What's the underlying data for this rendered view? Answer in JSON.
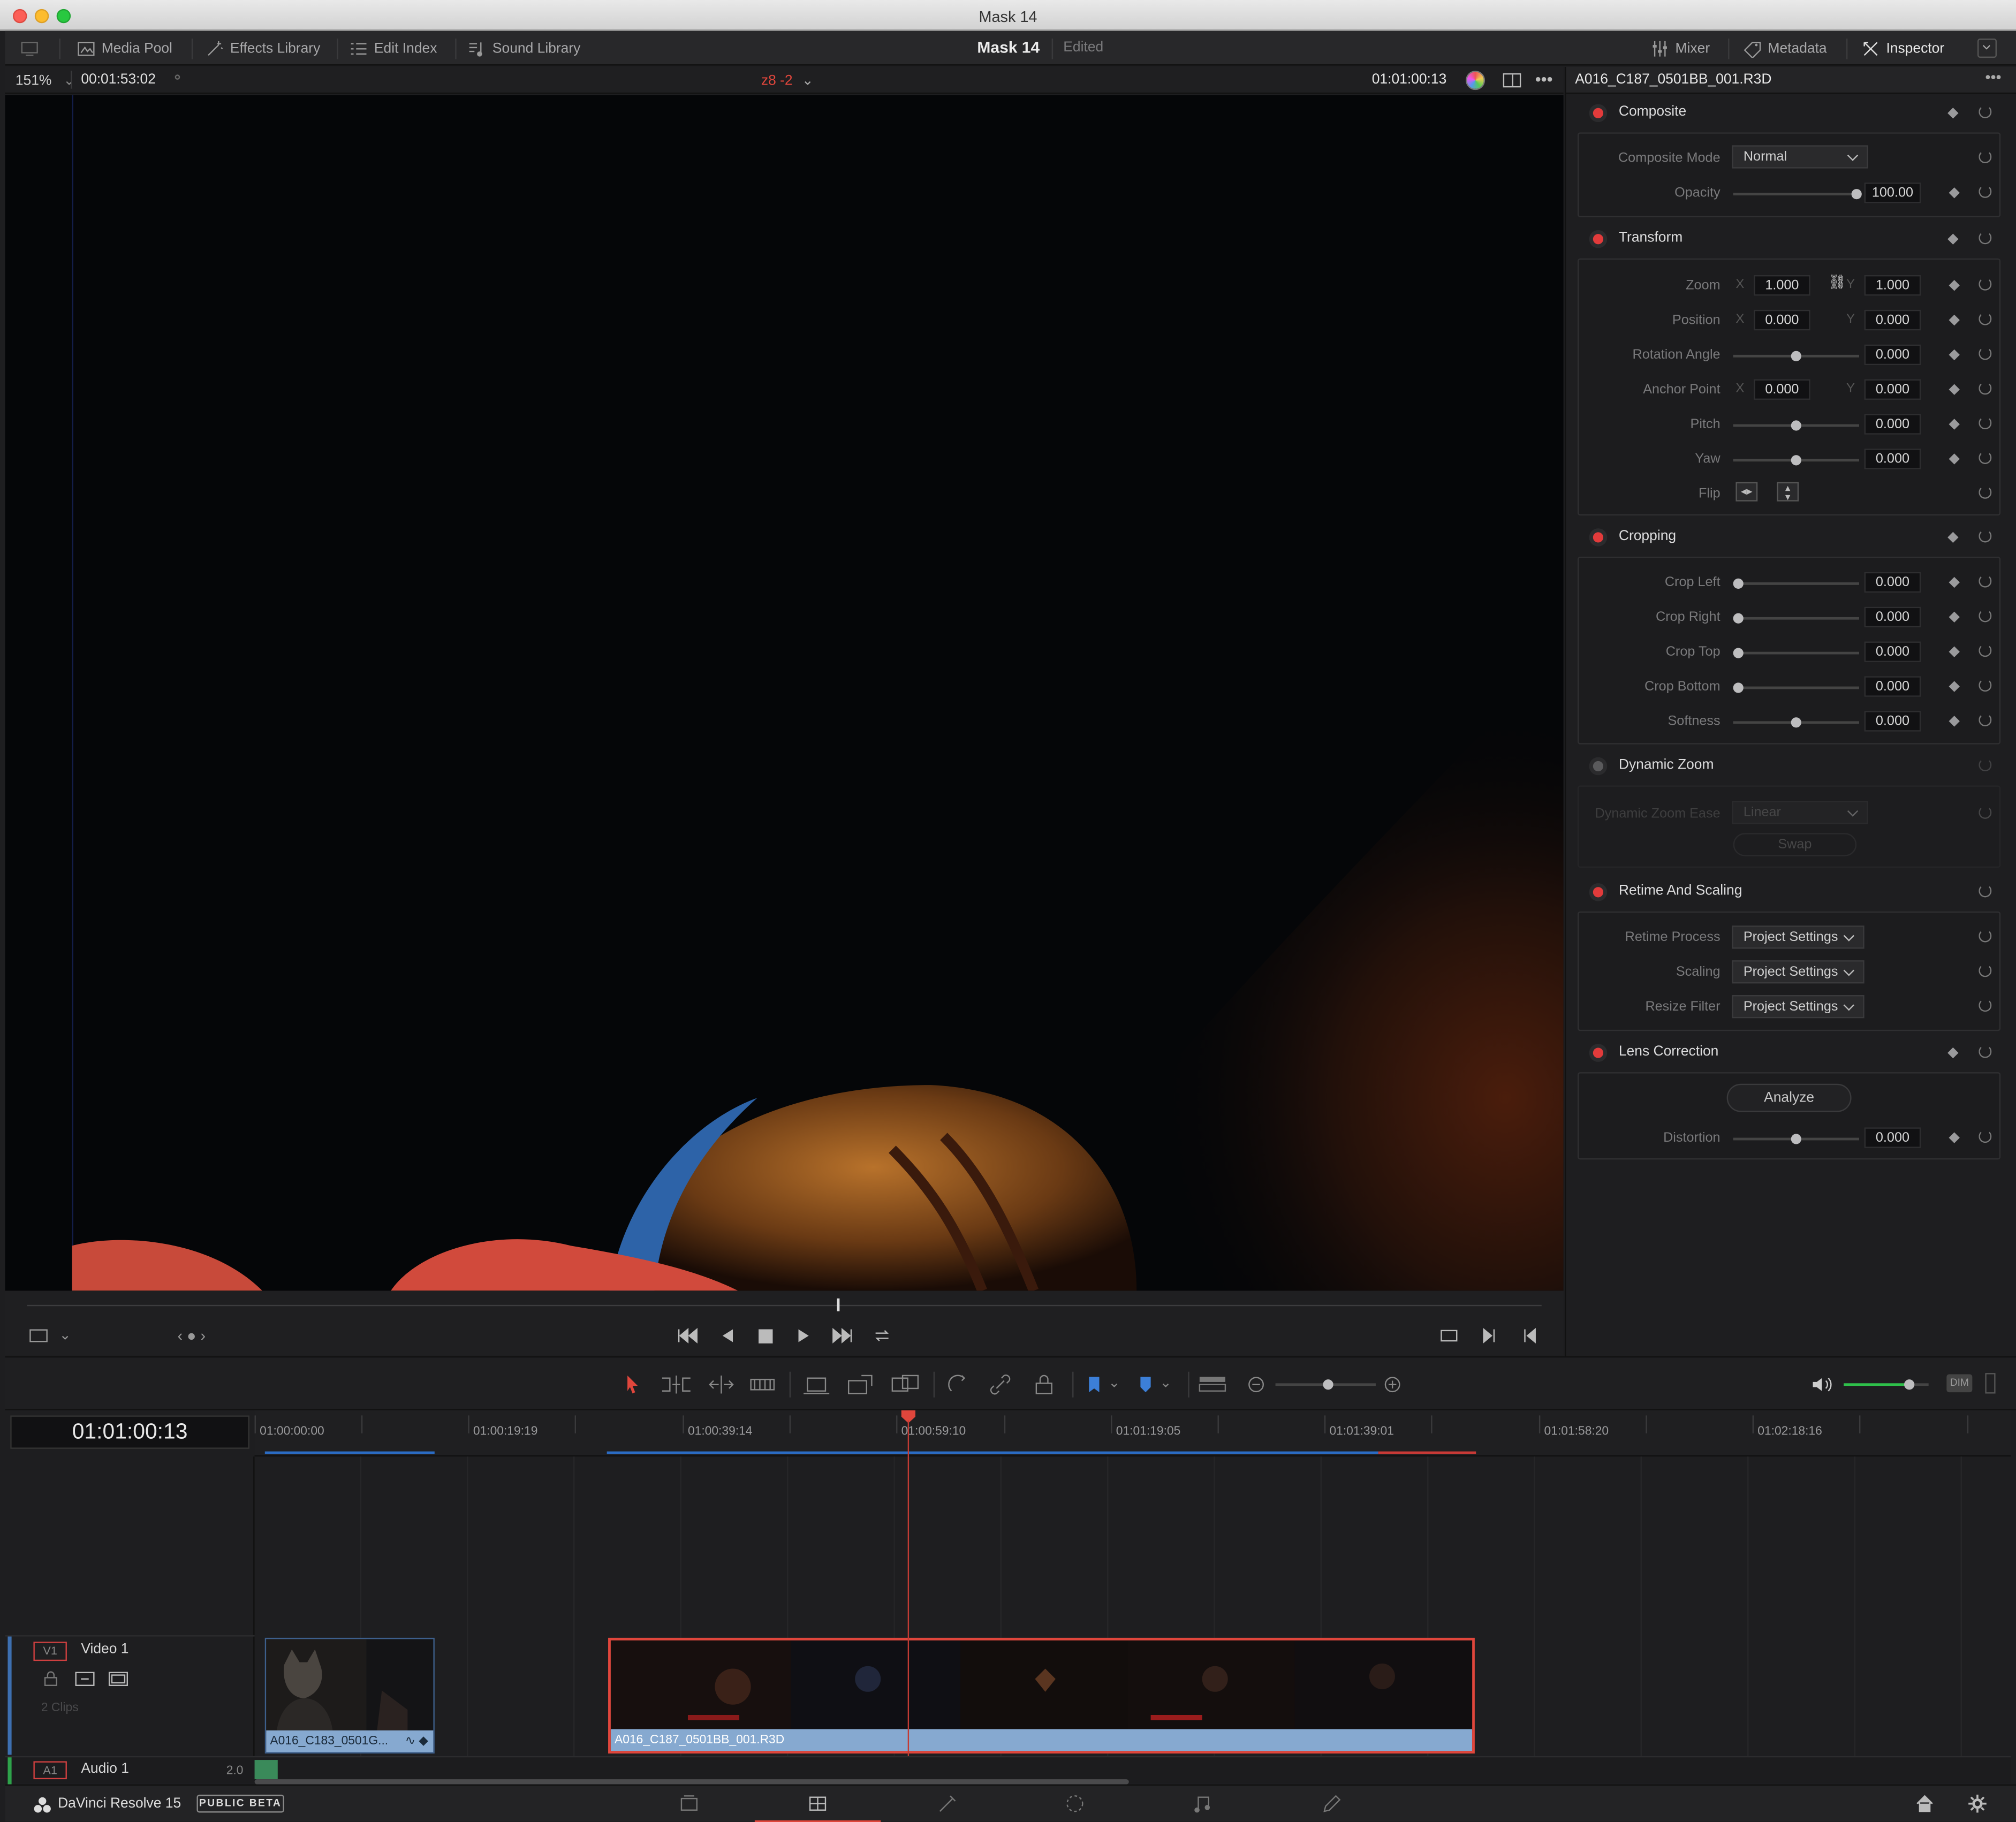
{
  "window": {
    "title": "Mask 14"
  },
  "toolbar": {
    "media_pool": "Media Pool",
    "effects_library": "Effects Library",
    "edit_index": "Edit Index",
    "sound_library": "Sound Library",
    "project_name": "Mask 14",
    "project_status": "Edited",
    "mixer": "Mixer",
    "metadata": "Metadata",
    "inspector": "Inspector"
  },
  "viewer": {
    "zoom": "151%",
    "source_timecode": "00:01:53:02",
    "clip_name": "z8 -2",
    "timecode": "01:01:00:13",
    "scrub_position": 0.535
  },
  "inspector": {
    "clip_name": "A016_C187_0501BB_001.R3D",
    "composite": {
      "title": "Composite",
      "mode_label": "Composite Mode",
      "mode_value": "Normal",
      "opacity_label": "Opacity",
      "opacity_value": "100.00"
    },
    "transform": {
      "title": "Transform",
      "zoom_label": "Zoom",
      "zoom_x": "1.000",
      "zoom_y": "1.000",
      "position_label": "Position",
      "position_x": "0.000",
      "position_y": "0.000",
      "rotation_label": "Rotation Angle",
      "rotation_value": "0.000",
      "anchor_label": "Anchor Point",
      "anchor_x": "0.000",
      "anchor_y": "0.000",
      "pitch_label": "Pitch",
      "pitch_value": "0.000",
      "yaw_label": "Yaw",
      "yaw_value": "0.000",
      "flip_label": "Flip",
      "x": "X",
      "y": "Y"
    },
    "cropping": {
      "title": "Cropping",
      "left_label": "Crop Left",
      "left_value": "0.000",
      "right_label": "Crop Right",
      "right_value": "0.000",
      "top_label": "Crop Top",
      "top_value": "0.000",
      "bottom_label": "Crop Bottom",
      "bottom_value": "0.000",
      "softness_label": "Softness",
      "softness_value": "0.000"
    },
    "dynamic_zoom": {
      "title": "Dynamic Zoom",
      "ease_label": "Dynamic Zoom Ease",
      "ease_value": "Linear",
      "swap_label": "Swap"
    },
    "retime": {
      "title": "Retime And Scaling",
      "process_label": "Retime Process",
      "process_value": "Project Settings",
      "scaling_label": "Scaling",
      "scaling_value": "Project Settings",
      "filter_label": "Resize Filter",
      "filter_value": "Project Settings"
    },
    "lens": {
      "title": "Lens Correction",
      "analyze_label": "Analyze",
      "distortion_label": "Distortion",
      "distortion_value": "0.000"
    }
  },
  "timeline": {
    "timecode": "01:01:00:13",
    "ruler": [
      "01:00:00:00",
      "01:00:19:19",
      "01:00:39:14",
      "01:00:59:10",
      "01:01:19:05",
      "01:01:39:01",
      "01:01:58:20",
      "01:02:18:16"
    ],
    "video_track": {
      "id": "V1",
      "name": "Video 1",
      "clip_count": "2 Clips"
    },
    "audio_track": {
      "id": "A1",
      "name": "Audio 1",
      "channels": "2.0"
    },
    "clips": [
      {
        "name": "A016_C183_0501G..."
      },
      {
        "name": "A016_C187_0501BB_001.R3D"
      }
    ],
    "volume_level": 0.78
  },
  "status": {
    "app_name": "DaVinci Resolve 15",
    "badge": "PUBLIC BETA",
    "dim": "DIM"
  },
  "colors": {
    "accent": "#e23b3b",
    "clip_blue": "#86a9d0",
    "playhead": "#d94040"
  }
}
